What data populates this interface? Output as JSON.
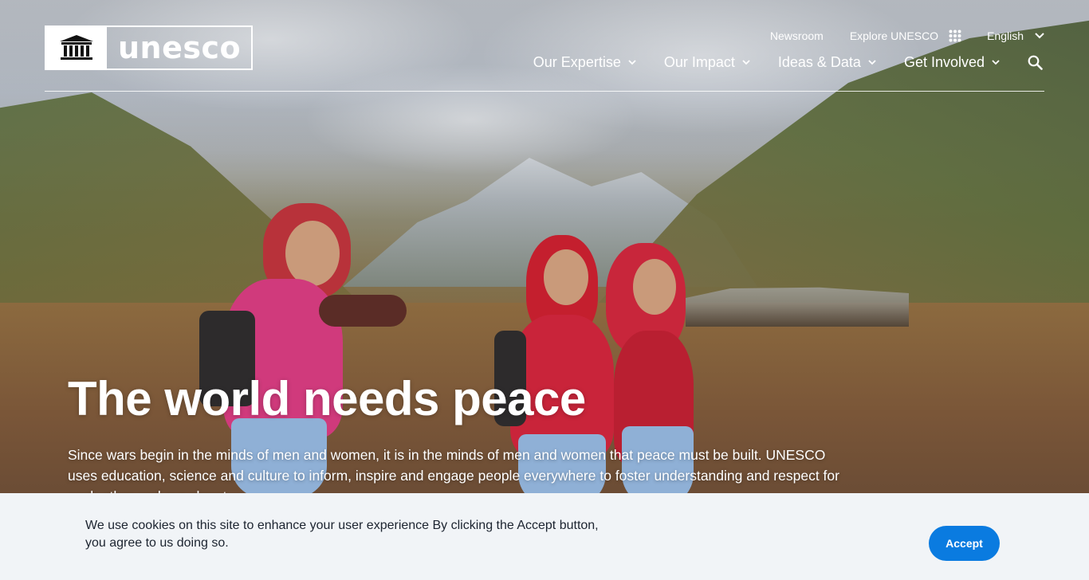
{
  "header": {
    "logo_text": "unesco",
    "utility_nav": {
      "newsroom": "Newsroom",
      "explore": "Explore UNESCO",
      "language": "English"
    },
    "main_nav": [
      {
        "label": "Our Expertise"
      },
      {
        "label": "Our Impact"
      },
      {
        "label": "Ideas & Data"
      },
      {
        "label": "Get Involved"
      }
    ],
    "icons": {
      "search": "search-icon",
      "grid": "grid-icon",
      "chevron": "chevron-down-icon"
    }
  },
  "hero": {
    "title": "The world needs peace",
    "text": "Since wars begin in the minds of men and women, it is in the minds of men and women that peace must be built. UNESCO uses education, science and culture to inform, inspire and engage people everywhere to foster understanding and respect for each other and our planet."
  },
  "cookie_banner": {
    "text": "We use cookies on this site to enhance your user experience   By clicking the Accept button, you agree to us doing so.",
    "accept_label": "Accept"
  },
  "colors": {
    "accent_button": "#0a7be0",
    "banner_bg": "#f1f4f7",
    "text_dark": "#1c2430"
  }
}
